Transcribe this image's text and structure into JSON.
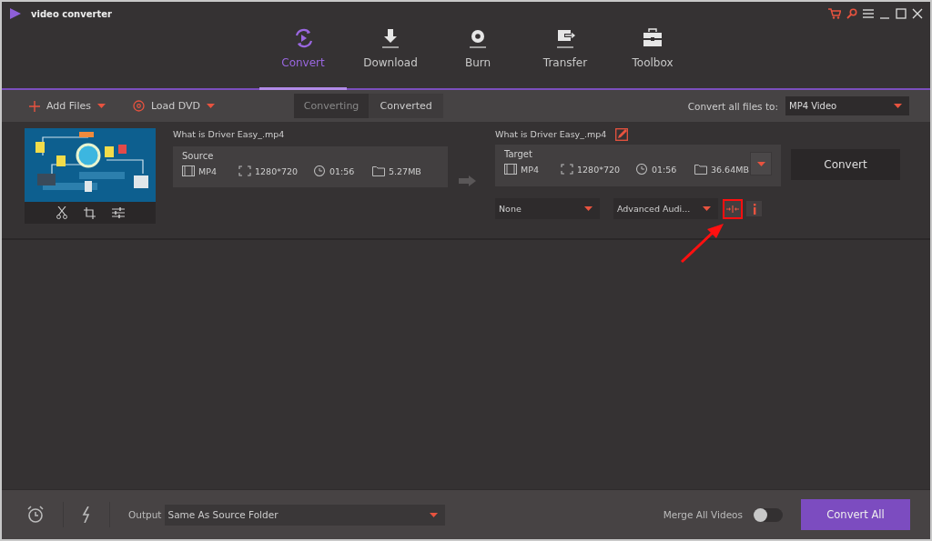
{
  "app": {
    "title": "video converter"
  },
  "nav_tabs": [
    {
      "label": "Convert",
      "selected": true
    },
    {
      "label": "Download",
      "selected": false
    },
    {
      "label": "Burn",
      "selected": false
    },
    {
      "label": "Transfer",
      "selected": false
    },
    {
      "label": "Toolbox",
      "selected": false
    }
  ],
  "toolbar": {
    "add_files": "Add Files",
    "load_dvd": "Load DVD",
    "tabs": [
      {
        "label": "Converting",
        "selected": true
      },
      {
        "label": "Converted",
        "selected": false
      }
    ],
    "convert_all_label": "Convert all files to:",
    "format": "MP4 Video"
  },
  "file": {
    "source_name": "What is Driver Easy_.mp4",
    "source": {
      "heading": "Source",
      "format": "MP4",
      "resolution": "1280*720",
      "duration": "01:56",
      "size": "5.27MB"
    },
    "target_name": "What is Driver Easy_.mp4",
    "target": {
      "heading": "Target",
      "format": "MP4",
      "resolution": "1280*720",
      "duration": "01:56",
      "size": "36.64MB"
    },
    "convert_button": "Convert",
    "subtitle": "None",
    "audio": "Advanced Audi...",
    "merge_highlighted": true
  },
  "footer": {
    "output_label": "Output",
    "output_path": "Same As Source Folder",
    "merge_label": "Merge All Videos",
    "merge_on": false,
    "convert_all_button": "Convert All"
  }
}
